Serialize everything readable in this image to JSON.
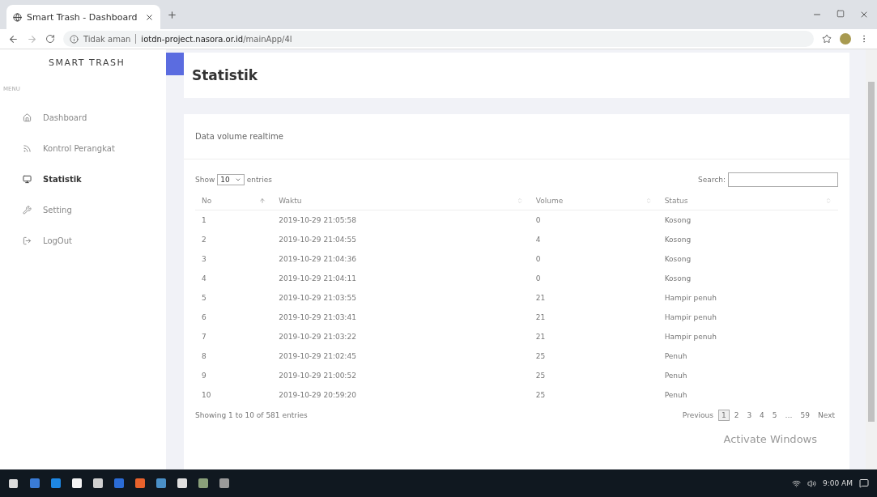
{
  "browser": {
    "tab_title": "Smart Trash - Dashboard",
    "security": "Tidak aman",
    "url_host": "iotdn-project.nasora.or.id",
    "url_path": "/mainApp/4l"
  },
  "sidebar": {
    "brand": "SMART TRASH",
    "section": "MENU",
    "items": [
      {
        "label": "Dashboard",
        "kind": "home",
        "selected": false
      },
      {
        "label": "Kontrol Perangkat",
        "kind": "control",
        "selected": false
      },
      {
        "label": "Statistik",
        "kind": "stats",
        "selected": true
      },
      {
        "label": "Setting",
        "kind": "setting",
        "selected": false
      },
      {
        "label": "LogOut",
        "kind": "logout",
        "selected": false
      }
    ]
  },
  "page_title": "Statistik",
  "card": {
    "title": "Data volume realtime",
    "length_label_before": "Show",
    "length_value": "10",
    "length_label_after": "entries",
    "search_label": "Search:",
    "columns": [
      "No",
      "Waktu",
      "Volume",
      "Status"
    ],
    "rows": [
      [
        "1",
        "2019-10-29 21:05:58",
        "0",
        "Kosong"
      ],
      [
        "2",
        "2019-10-29 21:04:55",
        "4",
        "Kosong"
      ],
      [
        "3",
        "2019-10-29 21:04:36",
        "0",
        "Kosong"
      ],
      [
        "4",
        "2019-10-29 21:04:11",
        "0",
        "Kosong"
      ],
      [
        "5",
        "2019-10-29 21:03:55",
        "21",
        "Hampir penuh"
      ],
      [
        "6",
        "2019-10-29 21:03:41",
        "21",
        "Hampir penuh"
      ],
      [
        "7",
        "2019-10-29 21:03:22",
        "21",
        "Hampir penuh"
      ],
      [
        "8",
        "2019-10-29 21:02:45",
        "25",
        "Penuh"
      ],
      [
        "9",
        "2019-10-29 21:00:52",
        "25",
        "Penuh"
      ],
      [
        "10",
        "2019-10-29 20:59:20",
        "25",
        "Penuh"
      ]
    ],
    "info": "Showing 1 to 10 of 581 entries",
    "pagination": [
      {
        "label": "Previous",
        "selected": false
      },
      {
        "label": "1",
        "selected": true
      },
      {
        "label": "2",
        "selected": false
      },
      {
        "label": "3",
        "selected": false
      },
      {
        "label": "4",
        "selected": false
      },
      {
        "label": "5",
        "selected": false
      },
      {
        "label": "…",
        "selected": false
      },
      {
        "label": "59",
        "selected": false
      },
      {
        "label": "Next",
        "selected": false
      }
    ]
  },
  "overlay": "Activate Windows",
  "taskbar": {
    "apps": [
      {
        "color": "#3a7bd5"
      },
      {
        "color": "#1e88e5"
      },
      {
        "color": "#f4f4f4"
      },
      {
        "color": "#d0d0d0"
      },
      {
        "color": "#2b6cd6"
      },
      {
        "color": "#e8622c"
      },
      {
        "color": "#4a90c8"
      },
      {
        "color": "#e0e0e0"
      },
      {
        "color": "#8aa07a"
      },
      {
        "color": "#9a9a9a"
      }
    ],
    "clock": "9:00 AM"
  }
}
